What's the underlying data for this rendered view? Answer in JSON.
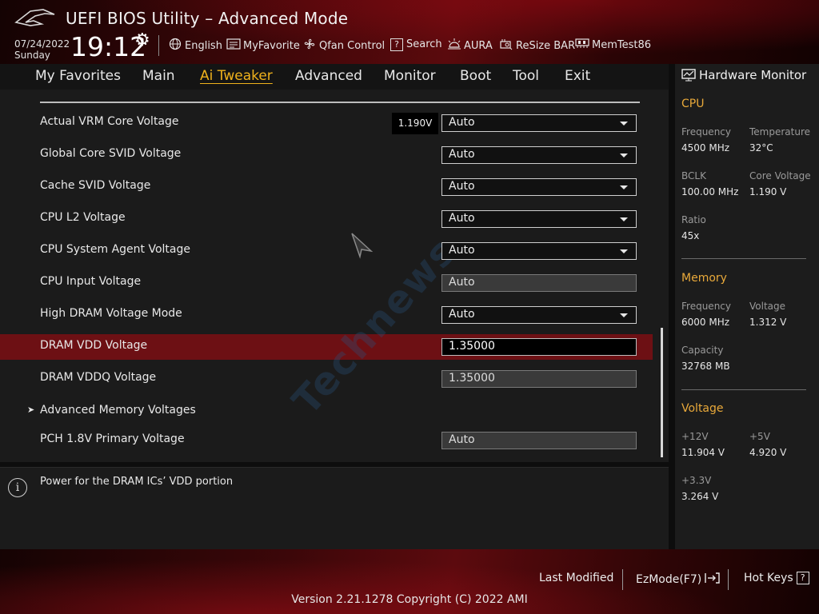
{
  "header": {
    "title": "UEFI BIOS Utility – Advanced Mode",
    "date": "07/24/2022",
    "day": "Sunday",
    "time": "19:12",
    "tools": [
      {
        "label": "English",
        "icon": "globe-icon"
      },
      {
        "label": "MyFavorite",
        "icon": "favorite-list-icon"
      },
      {
        "label": "Qfan Control",
        "icon": "fan-icon"
      },
      {
        "label": "Search",
        "icon": "search-help-icon"
      },
      {
        "label": "AURA",
        "icon": "aura-light-icon"
      },
      {
        "label": "ReSize BAR",
        "icon": "resize-bar-icon"
      },
      {
        "label": "MemTest86",
        "icon": "memtest-icon"
      }
    ]
  },
  "menu": {
    "tabs": [
      "My Favorites",
      "Main",
      "Ai Tweaker",
      "Advanced",
      "Monitor",
      "Boot",
      "Tool",
      "Exit"
    ],
    "active": "Ai Tweaker"
  },
  "settings": [
    {
      "label": "Actual VRM Core Voltage",
      "value": "Auto",
      "kind": "dropdown",
      "reading": "1.190V"
    },
    {
      "label": "Global Core SVID Voltage",
      "value": "Auto",
      "kind": "dropdown"
    },
    {
      "label": "Cache SVID Voltage",
      "value": "Auto",
      "kind": "dropdown"
    },
    {
      "label": "CPU L2 Voltage",
      "value": "Auto",
      "kind": "dropdown"
    },
    {
      "label": "CPU System Agent Voltage",
      "value": "Auto",
      "kind": "dropdown"
    },
    {
      "label": "CPU Input Voltage",
      "value": "Auto",
      "kind": "readonly"
    },
    {
      "label": "High DRAM Voltage Mode",
      "value": "Auto",
      "kind": "dropdown"
    },
    {
      "label": "DRAM VDD Voltage",
      "value": "1.35000",
      "kind": "input",
      "selected": true
    },
    {
      "label": "DRAM VDDQ Voltage",
      "value": "1.35000",
      "kind": "readonly"
    },
    {
      "label": "Advanced Memory Voltages",
      "kind": "submenu"
    },
    {
      "label": "PCH 1.8V Primary Voltage",
      "value": "Auto",
      "kind": "readonly"
    }
  ],
  "help": {
    "text": "Power for the DRAM ICs’ VDD portion"
  },
  "watermark": "Technews",
  "hardware_monitor": {
    "title": "Hardware Monitor",
    "cpu": {
      "heading": "CPU",
      "frequency_label": "Frequency",
      "frequency": "4500 MHz",
      "temperature_label": "Temperature",
      "temperature": "32°C",
      "bclk_label": "BCLK",
      "bclk": "100.00 MHz",
      "core_voltage_label": "Core Voltage",
      "core_voltage": "1.190 V",
      "ratio_label": "Ratio",
      "ratio": "45x"
    },
    "memory": {
      "heading": "Memory",
      "frequency_label": "Frequency",
      "frequency": "6000 MHz",
      "voltage_label": "Voltage",
      "voltage": "1.312 V",
      "capacity_label": "Capacity",
      "capacity": "32768 MB"
    },
    "voltage": {
      "heading": "Voltage",
      "v12_label": "+12V",
      "v12": "11.904 V",
      "v5_label": "+5V",
      "v5": "4.920 V",
      "v33_label": "+3.3V",
      "v33": "3.264 V"
    }
  },
  "footer": {
    "last_modified": "Last Modified",
    "ezmode": "EzMode(F7)",
    "hotkeys": "Hot Keys",
    "version": "Version 2.21.1278 Copyright (C) 2022 AMI"
  },
  "colors": {
    "accent": "#f0b21c",
    "section": "#e9a93a",
    "selected_row": "#6d1014"
  }
}
